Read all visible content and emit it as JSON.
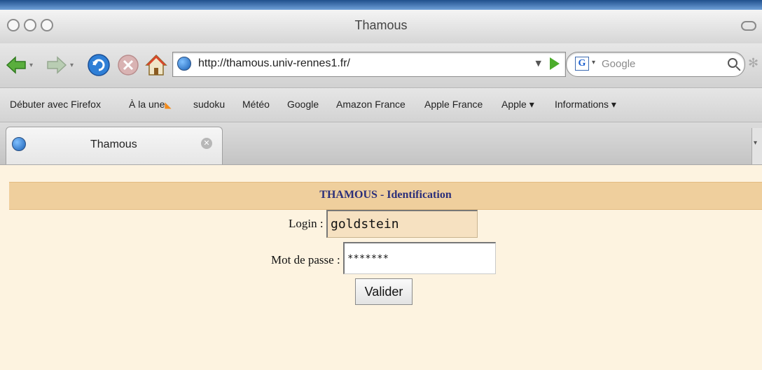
{
  "window": {
    "title": "Thamous"
  },
  "navigation": {
    "url": "http://thamous.univ-rennes1.fr/",
    "search_placeholder": "Google"
  },
  "bookmarks": [
    {
      "label": "Débuter avec Firefox"
    },
    {
      "label": "À la une"
    },
    {
      "label": "sudoku"
    },
    {
      "label": "Météo"
    },
    {
      "label": "Google"
    },
    {
      "label": "Amazon France"
    },
    {
      "label": "Apple France"
    },
    {
      "label": "Apple ▾"
    },
    {
      "label": "Informations ▾"
    }
  ],
  "tab": {
    "label": "Thamous"
  },
  "page": {
    "heading": "THAMOUS - Identification",
    "login_label": "Login :",
    "login_value": "goldstein",
    "password_label": "Mot de passe :",
    "password_value": "*******",
    "submit_label": "Valider"
  },
  "colors": {
    "page_bg": "#fdf3e0",
    "band_bg": "#efcf9d",
    "heading_text": "#2b2f7a"
  }
}
